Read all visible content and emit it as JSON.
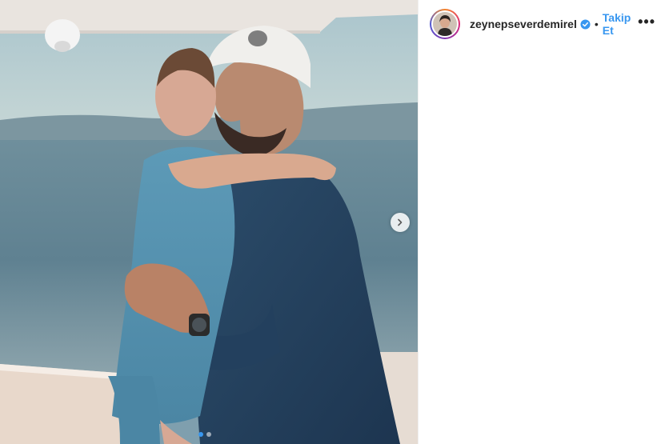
{
  "header": {
    "username": "zeynepseverdemirel",
    "verified_icon": "verified-badge-icon",
    "separator": "•",
    "follow_label": "Takip Et",
    "more_label": "•••"
  },
  "media": {
    "carousel_total": 2,
    "carousel_active": 1,
    "next_icon": "chevron-right-icon"
  },
  "colors": {
    "accent": "#3897f0",
    "text": "#262626"
  }
}
